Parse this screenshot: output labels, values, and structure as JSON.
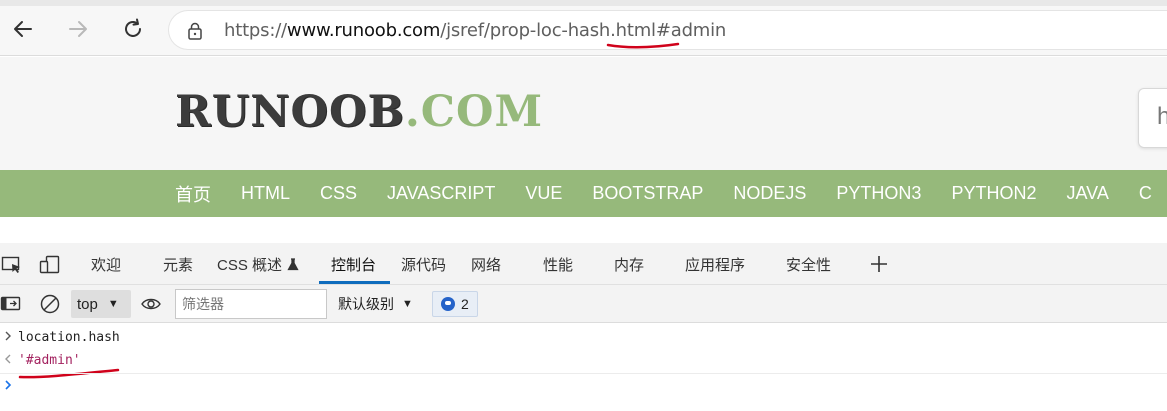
{
  "browser": {
    "url_scheme": "https://",
    "url_host": "www.runoob.com",
    "url_path": "/jsref/prop-loc-hash.html",
    "url_hash": "#admin",
    "icons": {
      "back": "arrow-left-icon",
      "forward": "arrow-right-icon",
      "reload": "reload-icon",
      "lock": "lock-icon"
    }
  },
  "site": {
    "logo_main": "RUNOOB",
    "logo_suffix": ".COM",
    "search_partial": "h",
    "nav": [
      "首页",
      "HTML",
      "CSS",
      "JAVASCRIPT",
      "VUE",
      "BOOTSTRAP",
      "NODEJS",
      "PYTHON3",
      "PYTHON2",
      "JAVA",
      "C"
    ],
    "colors": {
      "nav_green": "#96b97b",
      "header_bg": "#f6f6f6"
    }
  },
  "devtools": {
    "tabs": {
      "welcome": "欢迎",
      "elements": "元素",
      "css_overview": "CSS 概述",
      "console": "控制台",
      "sources": "源代码",
      "network": "网络",
      "performance": "性能",
      "memory": "内存",
      "application": "应用程序",
      "security": "安全性"
    },
    "active_tab": "console",
    "toolbar": {
      "context": "top",
      "filter_placeholder": "筛选器",
      "level": "默认级别",
      "issues_count": "2"
    },
    "console": {
      "input": "location.hash",
      "output": "'#admin'"
    },
    "colors": {
      "accent": "#0f6cbd",
      "string_result": "#a3225f",
      "annotation_red": "#d0021b"
    }
  }
}
